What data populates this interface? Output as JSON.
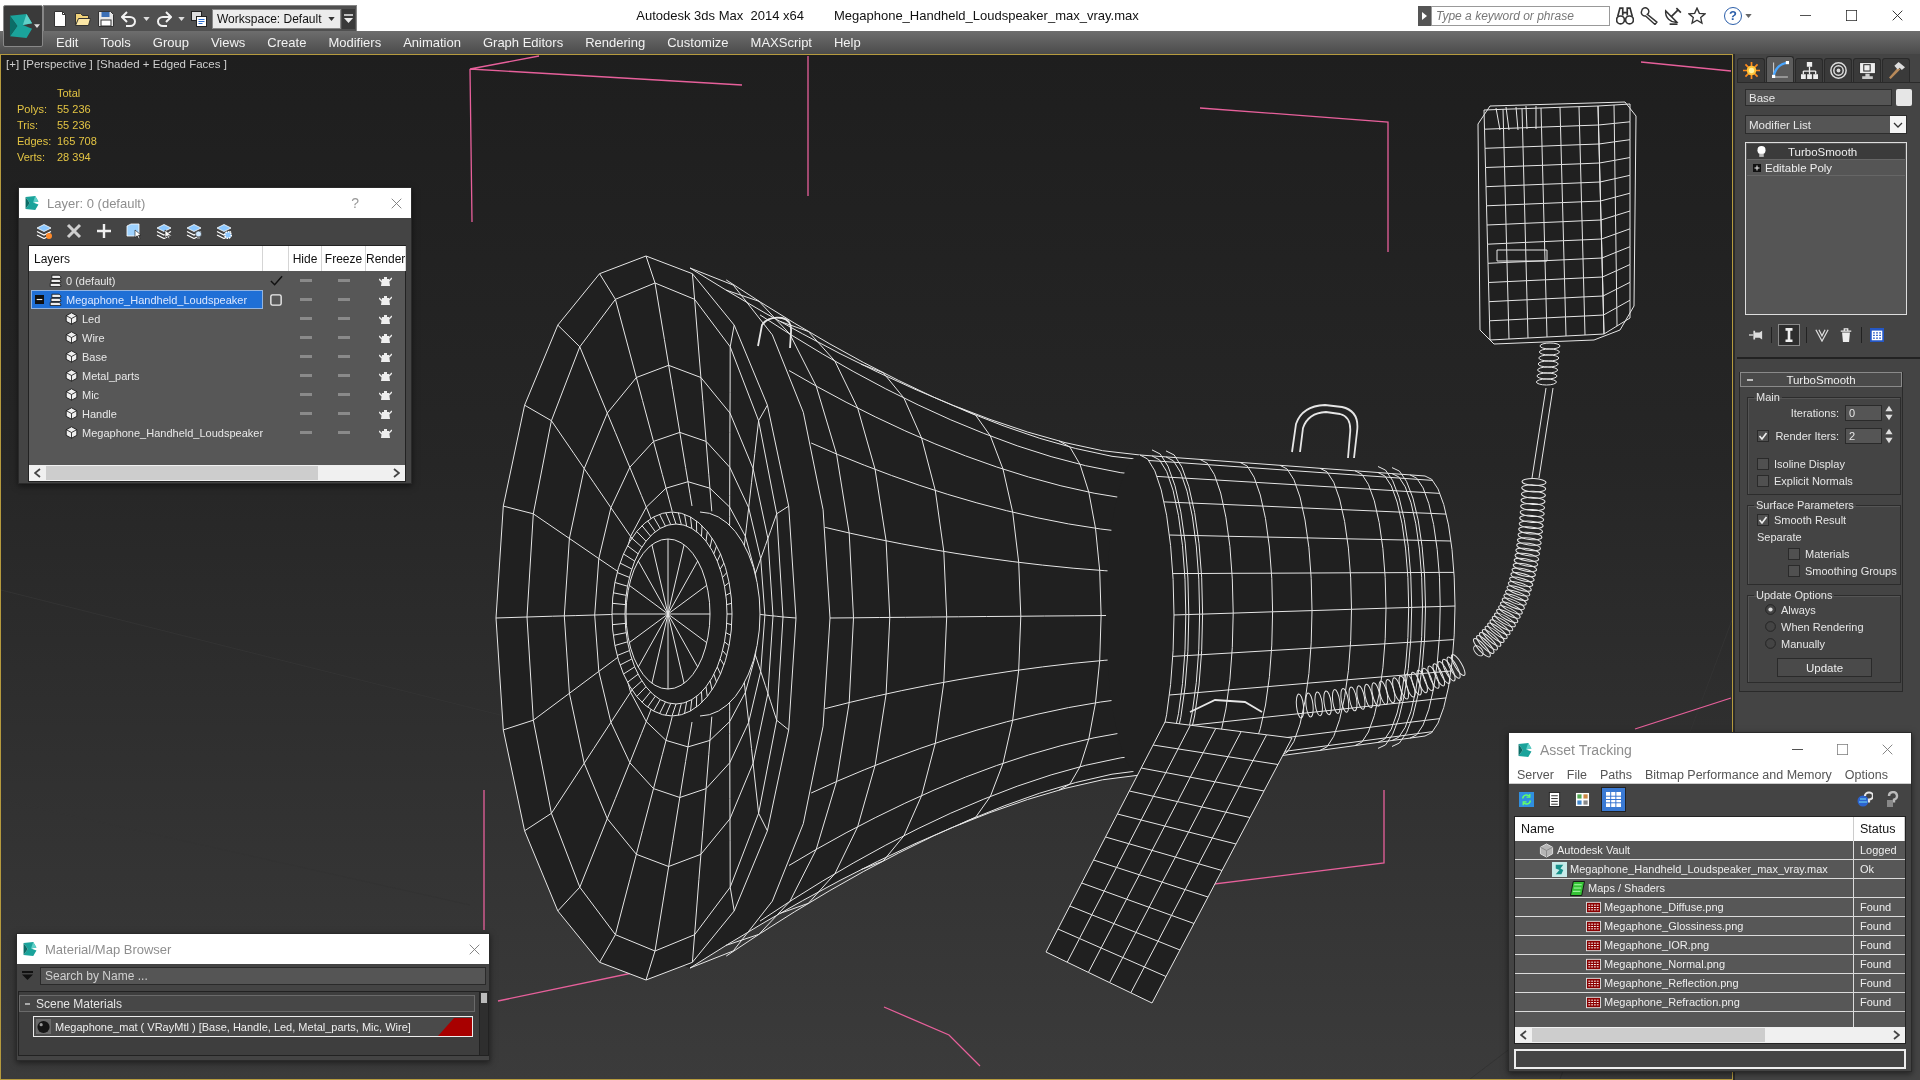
{
  "window": {
    "app_title": "Autodesk 3ds Max  2014 x64",
    "file_name": "Megaphone_Handheld_Loudspeaker_max_vray.max",
    "workspace": "Workspace: Default",
    "search": {
      "placeholder": "Type a keyword or phrase"
    },
    "help": "?"
  },
  "menu": [
    "Edit",
    "Tools",
    "Group",
    "Views",
    "Create",
    "Modifiers",
    "Animation",
    "Graph Editors",
    "Rendering",
    "Customize",
    "MAXScript",
    "Help"
  ],
  "viewport": {
    "labels": [
      "[+]",
      "[Perspective ]",
      "[Shaded + Edged Faces ]"
    ],
    "stats": {
      "heading": "Total",
      "rows": [
        {
          "label": "Polys:",
          "value": "55 236"
        },
        {
          "label": "Tris:",
          "value": "55 236"
        },
        {
          "label": "Edges:",
          "value": "165 708"
        },
        {
          "label": "Verts:",
          "value": "28 394"
        }
      ]
    }
  },
  "layer_dialog": {
    "title": "Layer: 0 (default)",
    "help": "?",
    "columns": [
      "Layers",
      "Hide",
      "Freeze",
      "Render"
    ],
    "layers": [
      {
        "name": "0 (default)",
        "current": true,
        "selected": false,
        "hide": false,
        "freeze": false,
        "render": true
      },
      {
        "name": "Megaphone_Handheld_Loudspeaker",
        "current": false,
        "selected": true,
        "expanded": true,
        "hide": false,
        "freeze": false,
        "render": true,
        "children": [
          {
            "name": "Led",
            "selected": false,
            "hide": false,
            "freeze": false,
            "render": true
          },
          {
            "name": "Wire",
            "selected": false,
            "hide": false,
            "freeze": false,
            "render": true
          },
          {
            "name": "Base",
            "selected": false,
            "hide": false,
            "freeze": false,
            "render": true
          },
          {
            "name": "Metal_parts",
            "selected": false,
            "hide": false,
            "freeze": false,
            "render": true
          },
          {
            "name": "Mic",
            "selected": false,
            "hide": false,
            "freeze": false,
            "render": true
          },
          {
            "name": "Handle",
            "selected": false,
            "hide": false,
            "freeze": false,
            "render": true
          },
          {
            "name": "Megaphone_Handheld_Loudspeaker",
            "selected": false,
            "hide": false,
            "freeze": false,
            "render": true
          }
        ]
      }
    ]
  },
  "material_browser": {
    "title": "Material/Map Browser",
    "search": {
      "placeholder": "Search by Name ..."
    },
    "groups": [
      {
        "title": "Scene Materials",
        "expanded": true,
        "items": [
          {
            "name": "Megaphone_mat ( VRayMtl ) [Base, Handle, Led, Metal_parts, Mic, Wire]",
            "selected": true,
            "in_scene": true
          }
        ]
      }
    ]
  },
  "command_panel": {
    "tabs": [
      {
        "kind": "create",
        "selected": false
      },
      {
        "kind": "modify",
        "selected": true
      },
      {
        "kind": "hierarchy",
        "selected": false
      },
      {
        "kind": "motion",
        "selected": false
      },
      {
        "kind": "display",
        "selected": false
      },
      {
        "kind": "utilities",
        "selected": false
      }
    ],
    "object_name": "Base",
    "modifier_list": "Modifier List",
    "stack": [
      {
        "name": "TurboSmooth",
        "kind": "modifier",
        "selected": true,
        "enabled": true
      },
      {
        "name": "Editable Poly",
        "kind": "base",
        "selected": false,
        "expanded": false
      }
    ],
    "stack_tools": [
      {
        "kind": "pin",
        "on": false
      },
      {
        "kind": "end_result",
        "on": true
      },
      {
        "kind": "unique",
        "on": false
      },
      {
        "kind": "remove",
        "on": false
      },
      {
        "kind": "configure",
        "on": false
      }
    ],
    "rollout": {
      "title": "TurboSmooth",
      "expanded": true,
      "groups": [
        {
          "title": "Main",
          "controls": [
            {
              "kind": "spinner",
              "label": "Iterations:",
              "value": "0"
            },
            {
              "kind": "check_spinner",
              "label": "Render Iters:",
              "value": "2",
              "checked": true
            },
            {
              "kind": "checkbox",
              "label": "Isoline Display",
              "checked": false
            },
            {
              "kind": "checkbox",
              "label": "Explicit Normals",
              "checked": false
            }
          ]
        },
        {
          "title": "Surface Parameters",
          "controls": [
            {
              "kind": "checkbox",
              "label": "Smooth Result",
              "checked": true
            },
            {
              "kind": "label",
              "label": "Separate",
              "children": [
                {
                  "kind": "checkbox",
                  "label": "Materials",
                  "checked": false
                },
                {
                  "kind": "checkbox",
                  "label": "Smoothing Groups",
                  "checked": false
                }
              ]
            }
          ]
        },
        {
          "title": "Update Options",
          "controls": [
            {
              "kind": "radio",
              "label": "Always",
              "selected": true
            },
            {
              "kind": "radio",
              "label": "When Rendering",
              "selected": false
            },
            {
              "kind": "radio",
              "label": "Manually",
              "selected": false
            },
            {
              "kind": "button",
              "label": "Update"
            }
          ]
        }
      ]
    }
  },
  "asset_tracking": {
    "title": "Asset Tracking",
    "menu": [
      "Server",
      "File",
      "Paths",
      "Bitmap Performance and Memory",
      "Options"
    ],
    "tools": [
      {
        "kind": "refresh",
        "on": false
      },
      {
        "kind": "list",
        "on": false
      },
      {
        "kind": "thumbnails",
        "on": false
      },
      {
        "kind": "table",
        "on": true
      }
    ],
    "columns": [
      "Name",
      "Status"
    ],
    "assets": [
      {
        "name": "Autodesk Vault",
        "kind": "vault",
        "status": "Logged",
        "selected": false,
        "children": [
          {
            "name": "Megaphone_Handheld_Loudspeaker_max_vray.max",
            "kind": "scene",
            "status": "Ok",
            "selected": false,
            "children": [
              {
                "name": "Maps / Shaders",
                "kind": "maps",
                "selected": false,
                "children": [
                  {
                    "name": "Megaphone_Diffuse.png",
                    "kind": "png",
                    "status": "Found",
                    "selected": false
                  },
                  {
                    "name": "Megaphone_Glossiness.png",
                    "kind": "png",
                    "status": "Found",
                    "selected": false
                  },
                  {
                    "name": "Megaphone_IOR.png",
                    "kind": "png",
                    "status": "Found",
                    "selected": false
                  },
                  {
                    "name": "Megaphone_Normal.png",
                    "kind": "png",
                    "status": "Found",
                    "selected": false
                  },
                  {
                    "name": "Megaphone_Reflection.png",
                    "kind": "png",
                    "status": "Found",
                    "selected": false
                  },
                  {
                    "name": "Megaphone_Refraction.png",
                    "kind": "png",
                    "status": "Found",
                    "selected": false
                  }
                ]
              }
            ]
          }
        ]
      }
    ]
  }
}
